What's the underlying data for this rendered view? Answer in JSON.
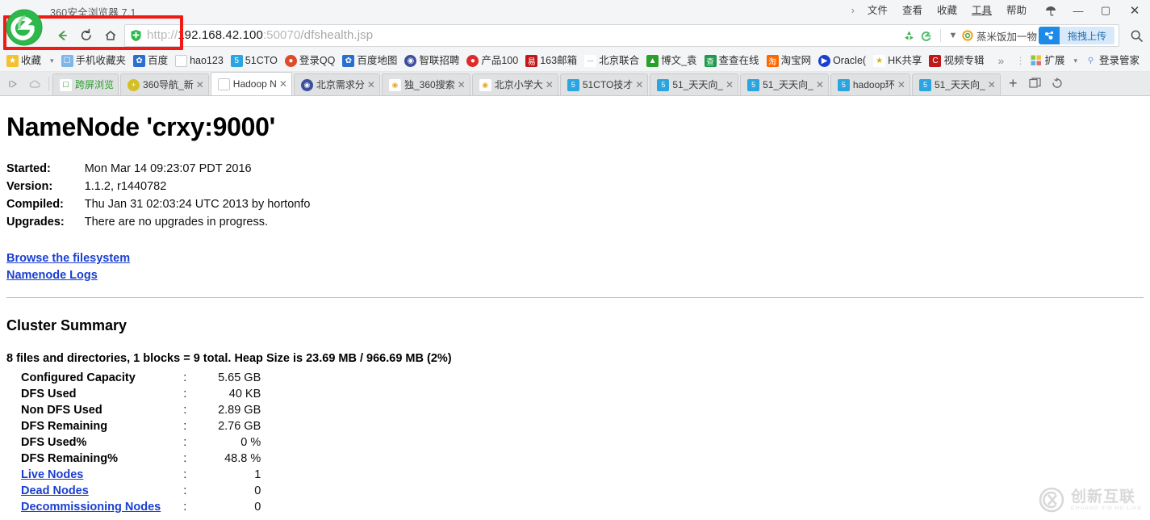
{
  "window": {
    "app_title": "360安全浏览器 7.1",
    "menu": [
      {
        "label": "文件",
        "active": false
      },
      {
        "label": "查看",
        "active": false
      },
      {
        "label": "收藏",
        "active": false
      },
      {
        "label": "工具",
        "active": true
      },
      {
        "label": "帮助",
        "active": false
      }
    ],
    "controls": {
      "skin_icon": "umbrella-icon",
      "minimize": "—",
      "maximize": "▢",
      "close": "✕"
    }
  },
  "navbar": {
    "back_icon": "back-arrow-icon",
    "reload_icon": "reload-icon",
    "home_icon": "home-icon",
    "shield_icon": "shield-icon",
    "url": {
      "scheme": "http://",
      "host": "192.168.42.100",
      "port": ":50070",
      "path": "/dfshealth.jsp",
      "full": "http://192.168.42.100:50070/dfshealth.jsp"
    },
    "right_icons": [
      "recycle-icon",
      "compatibility-e-icon",
      "chevron-down-icon"
    ],
    "search_engine": "360-search-icon",
    "search_suggestion": "蒸米饭加一物",
    "upload_button": "拖拽上传",
    "magnifier_icon": "search-icon"
  },
  "bookmarks": {
    "favorites_label": "收藏",
    "caret": "▾",
    "items": [
      {
        "label": "手机收藏夹",
        "icon": "phone-icon",
        "color": "#5a9de0"
      },
      {
        "label": "百度",
        "icon": "baidu-icon",
        "color": "#2a6fd0"
      },
      {
        "label": "hao123",
        "icon": "page-icon",
        "color": "#ffffff"
      },
      {
        "label": "51CTO",
        "icon": "cto-icon",
        "color": "#2aa5e0"
      },
      {
        "label": "登录QQ",
        "icon": "qq-icon",
        "color": "#e04a2a"
      },
      {
        "label": "百度地图",
        "icon": "baidu-map-icon",
        "color": "#2a6fd0"
      },
      {
        "label": "智联招聘",
        "icon": "zhaopin-icon",
        "color": "#3b4f9e"
      },
      {
        "label": "产品100",
        "icon": "product100-icon",
        "color": "#e02a2a"
      },
      {
        "label": "163邮箱",
        "icon": "netease-icon",
        "color": "#c01818"
      },
      {
        "label": "北京联合",
        "icon": "beijing-icon",
        "color": "#2a9ce0"
      },
      {
        "label": "博文_袁",
        "icon": "blog-icon",
        "color": "#2aa02a"
      },
      {
        "label": "查查在线",
        "icon": "chacha-icon",
        "color": "#1e9a4a"
      },
      {
        "label": "淘宝网",
        "icon": "taobao-icon",
        "color": "#ff6600"
      },
      {
        "label": "Oracle(",
        "icon": "oracle-icon",
        "color": "#1a3fd0"
      },
      {
        "label": "HK共享",
        "icon": "hk-icon",
        "color": "#e0b000"
      },
      {
        "label": "视频专辑",
        "icon": "video-icon",
        "color": "#c01818"
      }
    ],
    "overflow": "»",
    "extensions_label": "扩展",
    "extensions_caret": "▾",
    "login_manager_label": "登录管家"
  },
  "tabstrip": {
    "left_icons": [
      "play-icon",
      "cloud-icon"
    ],
    "tabs": [
      {
        "label": "跨屏浏览",
        "icon": "phone-icon",
        "color": "#2aa02a",
        "active": false,
        "closable": false
      },
      {
        "label": "360导航_新",
        "icon": "nav360-icon",
        "color": "#d4c024",
        "active": false,
        "closable": true
      },
      {
        "label": "Hadoop N",
        "icon": "page-icon",
        "color": "#ffffff",
        "active": true,
        "closable": true
      },
      {
        "label": "北京需求分",
        "icon": "zhaopin-icon",
        "color": "#3b4f9e",
        "active": false,
        "closable": true
      },
      {
        "label": "独_360搜索",
        "icon": "so360-icon",
        "color": "#e8a92a",
        "active": false,
        "closable": true
      },
      {
        "label": "北京小学大",
        "icon": "so360-icon",
        "color": "#e8a92a",
        "active": false,
        "closable": true
      },
      {
        "label": "51CTO技才",
        "icon": "cto-icon",
        "color": "#2aa5e0",
        "active": false,
        "closable": true
      },
      {
        "label": "51_天天向_",
        "icon": "cto-icon",
        "color": "#2aa5e0",
        "active": false,
        "closable": true
      },
      {
        "label": "51_天天向_",
        "icon": "cto-icon",
        "color": "#2aa5e0",
        "active": false,
        "closable": true
      },
      {
        "label": "hadoop环",
        "icon": "cto-icon",
        "color": "#2aa5e0",
        "active": false,
        "closable": true
      },
      {
        "label": "51_天天向_",
        "icon": "cto-icon",
        "color": "#2aa5e0",
        "active": false,
        "closable": true
      }
    ],
    "new_tab": "+",
    "restore_icon": "restore-tab-icon",
    "undo_icon": "undo-icon"
  },
  "page": {
    "title": "NameNode 'crxy:9000'",
    "meta": [
      {
        "key": "Started:",
        "value": "Mon Mar 14 09:23:07 PDT 2016"
      },
      {
        "key": "Version:",
        "value": "1.1.2, r1440782"
      },
      {
        "key": "Compiled:",
        "value": "Thu Jan 31 02:03:24 UTC 2013 by hortonfo"
      },
      {
        "key": "Upgrades:",
        "value": "There are no upgrades in progress."
      }
    ],
    "links": [
      "Browse the filesystem",
      "Namenode Logs"
    ],
    "cluster_summary_heading": "Cluster Summary",
    "summary_line": "8 files and directories, 1 blocks = 9 total. Heap Size is 23.69 MB / 966.69 MB (2%)",
    "stats": [
      {
        "label": "Configured Capacity",
        "colon": ":",
        "value": "5.65 GB",
        "link": false
      },
      {
        "label": "DFS Used",
        "colon": ":",
        "value": "40 KB",
        "link": false
      },
      {
        "label": "Non DFS Used",
        "colon": ":",
        "value": "2.89 GB",
        "link": false
      },
      {
        "label": "DFS Remaining",
        "colon": ":",
        "value": "2.76 GB",
        "link": false
      },
      {
        "label": "DFS Used%",
        "colon": ":",
        "value": "0 %",
        "link": false
      },
      {
        "label": "DFS Remaining%",
        "colon": ":",
        "value": "48.8 %",
        "link": false
      },
      {
        "label": "Live Nodes",
        "colon": ":",
        "value": "1",
        "link": true
      },
      {
        "label": "Dead Nodes",
        "colon": ":",
        "value": "0",
        "link": true
      },
      {
        "label": "Decommissioning Nodes",
        "colon": ":",
        "value": "0",
        "link": true
      }
    ],
    "link_color": "#1a3fd0"
  },
  "watermark": {
    "logo": "cx-logo-icon",
    "main": "创新互联",
    "sub": "CHUANG XIN HU LIAN"
  }
}
